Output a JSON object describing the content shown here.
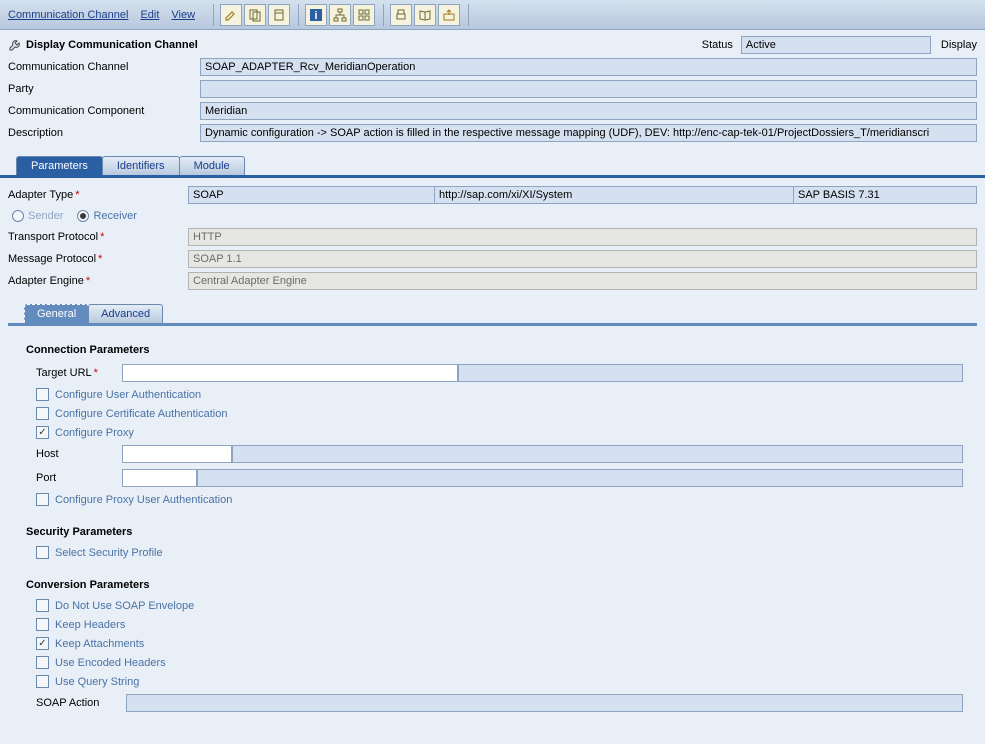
{
  "menubar": {
    "items": [
      "Communication Channel",
      "Edit",
      "View"
    ]
  },
  "header": {
    "title": "Display Communication Channel",
    "status_label": "Status",
    "status_value": "Active",
    "display_link": "Display"
  },
  "info": {
    "channel_label": "Communication Channel",
    "channel_value": "SOAP_ADAPTER_Rcv_MeridianOperation",
    "party_label": "Party",
    "party_value": "",
    "component_label": "Communication Component",
    "component_value": "Meridian",
    "description_label": "Description",
    "description_value": "Dynamic configuration -> SOAP action is filled in the respective message mapping (UDF), DEV: http://enc-cap-tek-01/ProjectDossiers_T/meridianscri"
  },
  "tabs": {
    "parameters": "Parameters",
    "identifiers": "Identifiers",
    "module": "Module"
  },
  "params": {
    "adapter_type_label": "Adapter Type",
    "adapter_type_value": "SOAP",
    "adapter_ns": "http://sap.com/xi/XI/System",
    "adapter_swcv": "SAP BASIS 7.31",
    "sender_label": "Sender",
    "receiver_label": "Receiver",
    "transport_label": "Transport Protocol",
    "transport_value": "HTTP",
    "message_label": "Message Protocol",
    "message_value": "SOAP 1.1",
    "engine_label": "Adapter Engine",
    "engine_value": "Central Adapter Engine"
  },
  "subtabs": {
    "general": "General",
    "advanced": "Advanced"
  },
  "general": {
    "conn_title": "Connection Parameters",
    "target_url_label": "Target URL",
    "target_url_value": "",
    "cfg_user_auth": "Configure User Authentication",
    "cfg_cert_auth": "Configure Certificate Authentication",
    "cfg_proxy": "Configure Proxy",
    "host_label": "Host",
    "host_value": "",
    "port_label": "Port",
    "port_value": "",
    "cfg_proxy_user_auth": "Configure Proxy User Authentication",
    "sec_title": "Security Parameters",
    "select_security": "Select Security Profile",
    "conv_title": "Conversion Parameters",
    "no_envelope": "Do Not Use SOAP Envelope",
    "keep_headers": "Keep Headers",
    "keep_attachments": "Keep Attachments",
    "encoded_headers": "Use Encoded Headers",
    "query_string": "Use Query String",
    "soap_action_label": "SOAP Action",
    "soap_action_value": ""
  }
}
